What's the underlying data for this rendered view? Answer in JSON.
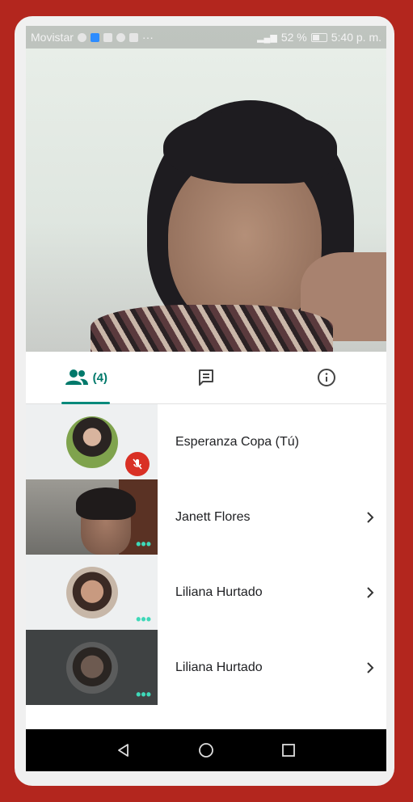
{
  "status_bar": {
    "carrier": "Movistar",
    "battery": "52 %",
    "time": "5:40 p. m."
  },
  "tabs": [
    {
      "icon": "people-icon",
      "count": "(4)",
      "active": true
    },
    {
      "icon": "chat-icon",
      "active": false
    },
    {
      "icon": "info-icon",
      "active": false
    }
  ],
  "participants": [
    {
      "name": "Esperanza Copa (Tú)",
      "muted": true
    },
    {
      "name": "Janett Flores",
      "more": true
    },
    {
      "name": "Liliana Hurtado",
      "more": true
    },
    {
      "name": "Liliana Hurtado",
      "more": true
    }
  ],
  "dots": "•••",
  "colors": {
    "accent": "#00897b",
    "mute": "#d93025",
    "frame": "#b3261e"
  }
}
